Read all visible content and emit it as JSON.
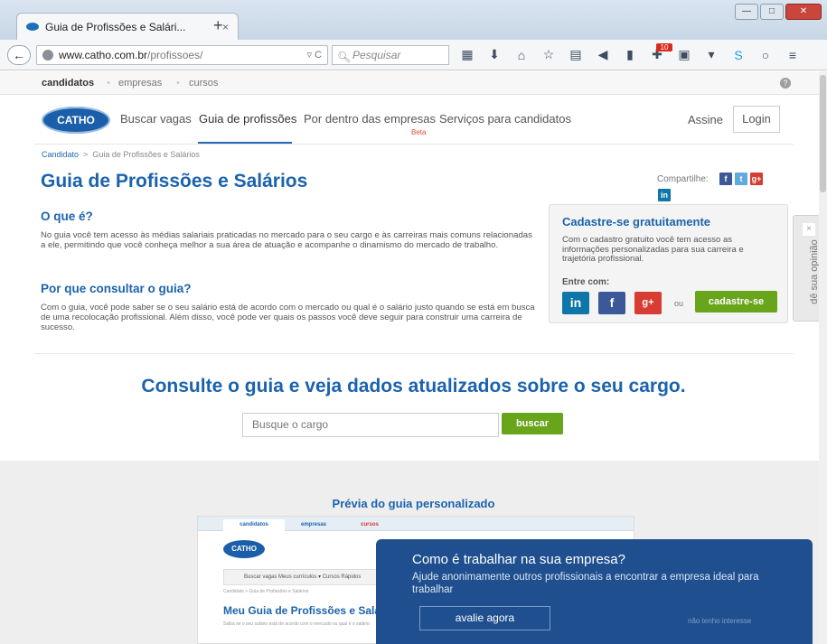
{
  "browser": {
    "tab_title": "Guia de Profissões e Salári...",
    "tab_close": "×",
    "new_tab": "+",
    "url_host": "www.catho.com.br",
    "url_path": "/profissoes/",
    "search_placeholder": "Pesquisar",
    "badge_count": "10",
    "window_buttons": [
      "—",
      "□",
      "✕"
    ]
  },
  "topstrip": {
    "candidatos": "candidatos",
    "empresas": "empresas",
    "cursos": "cursos",
    "help": "?"
  },
  "header": {
    "logo": "CATHO",
    "nav": [
      "Buscar vagas",
      "Guia de profissões",
      "Por dentro das empresas",
      "Serviços para candidatos"
    ],
    "beta": "Beta",
    "assine": "Assine",
    "login": "Login"
  },
  "breadcrumb": {
    "root": "Candidato",
    "sep": ">",
    "current": "Guia de Profissões e Salários"
  },
  "page": {
    "title": "Guia de Profissões e Salários",
    "share_label": "Compartilhe:",
    "q1": "O que é?",
    "p1": "No guia você tem acesso às médias salariais praticadas no mercado para o seu cargo e às carreiras mais comuns relacionadas a ele, permitindo que você conheça melhor a sua área de atuação e acompanhe o dinamismo do mercado de trabalho.",
    "q2": "Por que consultar o guia?",
    "p2": "Com o guia, você pode saber se o seu salário está de acordo com o mercado ou qual é o salário justo quando se está em busca de uma recolocação profissional. Além disso, você pode ver quais os passos você deve seguir para construir uma carreira de sucesso."
  },
  "signup": {
    "title": "Cadastre-se gratuitamente",
    "desc": "Com o cadastro gratuito você tem acesso as informações personalizadas para sua carreira e trajetória profissional.",
    "enter_with": "Entre com:",
    "or": "ou",
    "button": "cadastre-se"
  },
  "feedback": {
    "close": "×",
    "label": "dê sua opinião"
  },
  "consult": {
    "headline": "Consulte o guia e veja dados atualizados sobre o seu cargo.",
    "placeholder": "Busque o cargo",
    "button": "buscar"
  },
  "preview": {
    "title": "Prévia do guia personalizado",
    "tabs": [
      "candidatos",
      "empresas",
      "cursos"
    ],
    "logo": "CATHO",
    "nav": "Buscar vagas    Meus currículos ▾    Cursos Rápidos",
    "crumb": "Candidato > Guia de Profissões e Salários",
    "heading": "Meu Guia de Profissões e Salários",
    "text": "Saiba se o seu salário está de acordo com o mercado ou qual é o salário"
  },
  "popup": {
    "title": "Como é trabalhar na sua empresa?",
    "desc": "Ajude anonimamente outros profissionais a encontrar a empresa ideal para trabalhar",
    "button": "avalie agora",
    "dismiss": "não tenho interesse"
  },
  "colors": {
    "brand_blue": "#1b63ad",
    "green": "#69a51b",
    "popup_bg": "#1f4f8f"
  }
}
